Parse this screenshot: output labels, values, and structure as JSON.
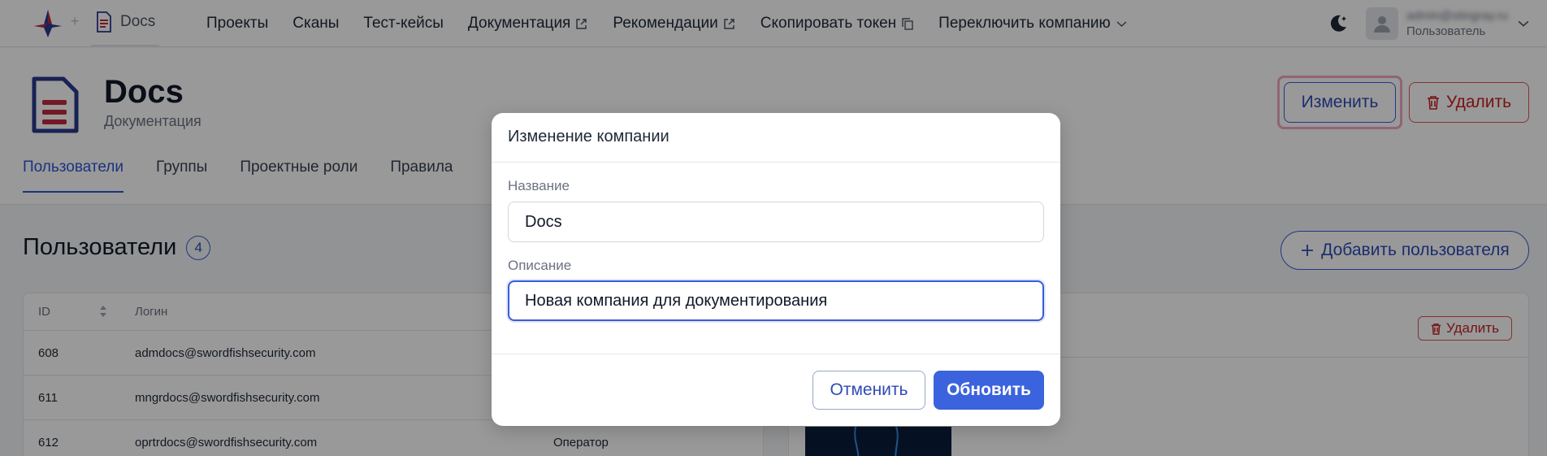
{
  "topbar": {
    "brand_label": "Docs",
    "nav": [
      {
        "label": "Проекты",
        "external": false
      },
      {
        "label": "Сканы",
        "external": false
      },
      {
        "label": "Тест-кейсы",
        "external": false
      },
      {
        "label": "Документация",
        "external": true
      },
      {
        "label": "Рекомендации",
        "external": true
      },
      {
        "label": "Скопировать токен",
        "external": false
      },
      {
        "label": "Переключить компанию",
        "external": false
      }
    ],
    "user": {
      "email": "admin@stingray.ru",
      "role": "Пользователь"
    }
  },
  "header": {
    "title": "Docs",
    "subtitle": "Документация",
    "edit_label": "Изменить",
    "delete_label": "Удалить",
    "tabs": [
      {
        "label": "Пользователи",
        "active": true
      },
      {
        "label": "Группы",
        "active": false
      },
      {
        "label": "Проектные роли",
        "active": false
      },
      {
        "label": "Правила",
        "active": false
      }
    ]
  },
  "users_section": {
    "title": "Пользователи",
    "count": "4",
    "add_label": "Добавить пользователя",
    "columns": {
      "id": "ID",
      "login": "Логин"
    },
    "rows": [
      {
        "id": "608",
        "login": "admdocs@swordfishsecurity.com",
        "role": ""
      },
      {
        "id": "611",
        "login": "mngrdocs@swordfishsecurity.com",
        "role": ""
      },
      {
        "id": "612",
        "login": "oprtrdocs@swordfishsecurity.com",
        "role": "Оператор"
      }
    ],
    "detail_delete_label": "Удалить"
  },
  "modal": {
    "title": "Изменение компании",
    "name_label": "Название",
    "name_value": "Docs",
    "desc_label": "Описание",
    "desc_value": "Новая компания для документирования",
    "cancel_label": "Отменить",
    "update_label": "Обновить"
  },
  "colors": {
    "accent": "#3b63dd",
    "danger": "#c81e1e",
    "brand_red": "#c0283c"
  }
}
